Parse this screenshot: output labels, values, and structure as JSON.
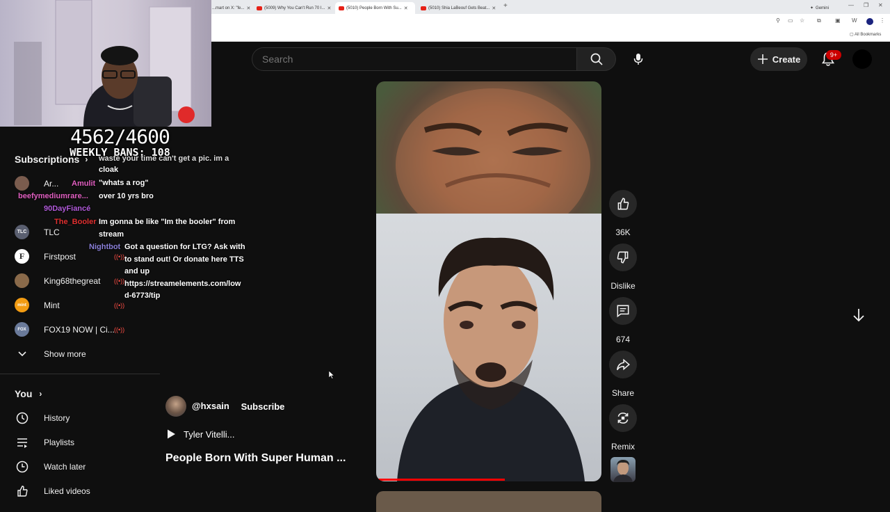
{
  "browser": {
    "tabs": [
      {
        "label": "...mart on X: \"fe...",
        "active": false
      },
      {
        "label": "(5009) Why You Can't Run 70 I...",
        "active": false
      },
      {
        "label": "(5010) People Born With Su...",
        "active": true
      },
      {
        "label": "(5010) Shia LaBeouf Gets Beat...",
        "active": false
      }
    ],
    "gemini_label": "Gemini",
    "all_bookmarks": "All Bookmarks"
  },
  "overlay": {
    "bans_count": "4562/4600",
    "weekly_bans": "WEEKLY BANS: 108"
  },
  "chat": [
    {
      "user": "",
      "text": "waste your time can't get a pic. im a",
      "user_color": "#ffffff"
    },
    {
      "user": "",
      "text": "cloak",
      "user_color": "#ffffff"
    },
    {
      "user": "Amulit",
      "text": "\"whats a rog\"",
      "user_color": "#e05fc0"
    },
    {
      "user": "beefymediumrare...",
      "text": "over 10 yrs bro",
      "user_color": "#e05fc0"
    },
    {
      "user": "90DayFiancé",
      "text": "",
      "user_color": "#b05ad9"
    },
    {
      "user": "The_Booler",
      "text": "Im gonna be like \"Im the booler\" from stream",
      "user_color": "#e03030"
    },
    {
      "user": "Nightbot",
      "text": "Got a question for LTG? Ask with to stand out! Or donate here TTS and up https://streamelements.com/lowd-6773/tip",
      "user_color": "#8a7fd8"
    }
  ],
  "chat_lines": {
    "l1": "waste your time can't get a pic. im a",
    "l2": "cloak",
    "l3": "\"whats a rog\"",
    "l4": "over 10 yrs bro",
    "l5": "Im gonna be like \"Im the booler\" from",
    "l6": "stream",
    "l7": "Got a question for LTG? Ask with",
    "l8": "to stand out! Or donate here TTS",
    "l9": "and up",
    "l10": "https://streamelements.com/low",
    "l11": "d-6773/tip"
  },
  "sidebar": {
    "subscriptions_heading": "Subscriptions",
    "subscriptions": [
      {
        "label": "Ar...",
        "live": false,
        "avatar_color": "#7a5c4e"
      },
      {
        "label": "TLC",
        "live": false,
        "avatar_color": "#5a5f70",
        "avatar_text": "TLC"
      },
      {
        "label": "Firstpost",
        "live": true,
        "avatar_color": "#ffffff",
        "avatar_text": "F"
      },
      {
        "label": "King68thegreat",
        "live": true,
        "avatar_color": "#8a6a4a"
      },
      {
        "label": "Mint",
        "live": true,
        "avatar_color": "#f39c12",
        "avatar_text": "mint"
      },
      {
        "label": "FOX19 NOW | Ci...",
        "live": true,
        "avatar_color": "#6a7a9a",
        "avatar_text": "FOX"
      }
    ],
    "show_more": "Show more",
    "you_heading": "You",
    "you_items": [
      {
        "label": "History",
        "icon": "history-icon"
      },
      {
        "label": "Playlists",
        "icon": "playlists-icon"
      },
      {
        "label": "Watch later",
        "icon": "watch-later-icon"
      },
      {
        "label": "Liked videos",
        "icon": "liked-icon"
      }
    ]
  },
  "header": {
    "search_placeholder": "Search",
    "create_label": "Create",
    "notification_count": "9+"
  },
  "short": {
    "channel_handle": "@hxsain",
    "subscribe_label": "Subscribe",
    "sound_label": "Tyler Vitelli...",
    "title": "People Born With Super Human ...",
    "progress_fraction": 0.57,
    "like_count": "36K",
    "dislike_label": "Dislike",
    "comment_count": "674",
    "share_label": "Share",
    "remix_label": "Remix"
  },
  "colors": {
    "background": "#0f0f0f",
    "accent_red": "#ff0000",
    "live_red": "#ff4e45"
  }
}
